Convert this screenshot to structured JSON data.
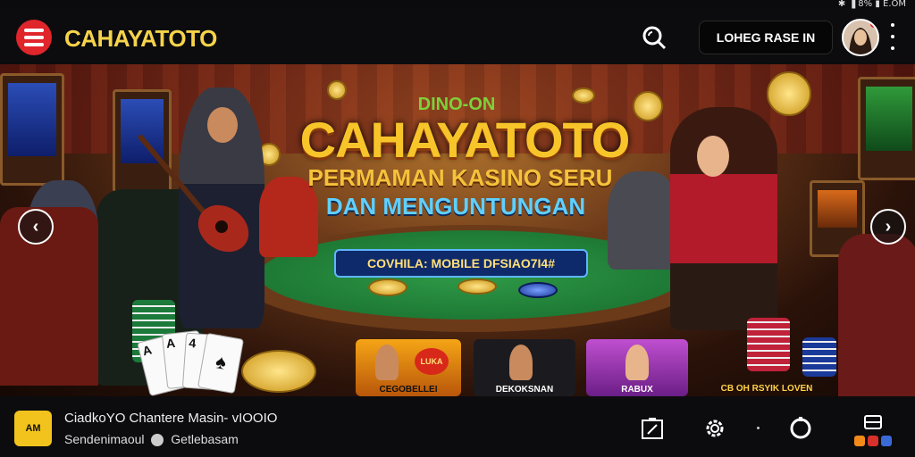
{
  "status_bar": {
    "text": "✱ ▐ 8% ▮ E.OM"
  },
  "header": {
    "brand": "CAHAYATOTO",
    "login_label": "LOHEG RASE IN"
  },
  "hero": {
    "small_title": "DINO-ON",
    "title": "CAHAYATOTO",
    "subtitle_line1": "PERMAMAN KASINO SERU",
    "subtitle_line2": "DAN MENGUNTUNGAN",
    "promo_text": "COVHILA: MOBILE DFSIAO7I4#",
    "prev_arrow": "‹",
    "next_arrow": "›",
    "cards": [
      {
        "label": "CEGOBELLEI",
        "badge": "LUKA"
      },
      {
        "label": "DEKOKSNAN"
      },
      {
        "label": "RABUX"
      },
      {
        "label": "CB OH RSYIK LOVEN"
      }
    ],
    "playing_cards": [
      "A",
      "A",
      "4",
      "♠"
    ]
  },
  "bottom_bar": {
    "app_icon_label": "AM",
    "line1": "CiadkoYO Chantere Masin- vIOOIO",
    "line2_a": "Sendenimaoul",
    "line2_b": "Getlebasam"
  },
  "colors": {
    "brand_yellow": "#f6d34a",
    "logo_red": "#e0252b",
    "title_gold": "#f7c52a",
    "subtitle_blue": "#5fd0ff",
    "felt_green": "#1f8a3a"
  },
  "icons": [
    "menu-logo-icon",
    "search-icon",
    "more-vertical-icon",
    "chevron-left-icon",
    "chevron-right-icon",
    "share-icon",
    "settings-icon",
    "circle-icon",
    "app-switcher-icon"
  ]
}
